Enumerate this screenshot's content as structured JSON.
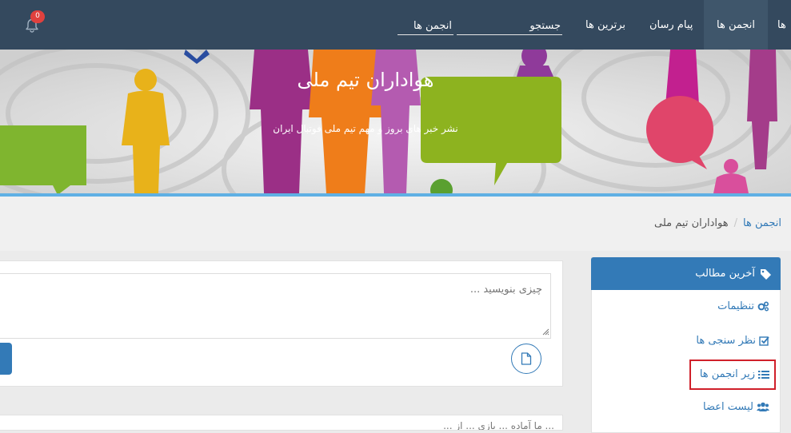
{
  "navbar": {
    "items": [
      {
        "label": "ها"
      },
      {
        "label": "انجمن ها"
      },
      {
        "label": "پیام رسان"
      },
      {
        "label": "برترین ها"
      }
    ],
    "search_label": "جستجو",
    "search_value": "انجمن ها",
    "notification_count": "0",
    "bell_icon": "bell-icon"
  },
  "banner": {
    "title": "هواداران تیم ملی",
    "subtitle": "نشر خبر های بروز و مهم تیم ملی فوتبال ایران"
  },
  "breadcrumb": {
    "link": "انجمن ها",
    "separator": "/",
    "current": "هواداران تیم ملی"
  },
  "composer": {
    "placeholder": "چیزی بنویسید ...",
    "attach_icon": "file-icon"
  },
  "next_post": {
    "preview": "... ما آماده ... بازی ... از ..."
  },
  "sidebar": {
    "header": "آخرین مطالب",
    "header_icon": "tags-icon",
    "items": [
      {
        "label": "تنظیمات",
        "icon": "cogs-icon"
      },
      {
        "label": "نظر سنجی ها",
        "icon": "check-square-icon"
      },
      {
        "label": "زیر انجمن ها",
        "icon": "list-icon"
      },
      {
        "label": "لیست اعضا",
        "icon": "users-icon"
      }
    ]
  },
  "colors": {
    "navbar": "#34495e",
    "accent": "#337ab7",
    "banner_border": "#5fb0e4",
    "highlight": "#d0202a",
    "badge": "#e0413e"
  }
}
